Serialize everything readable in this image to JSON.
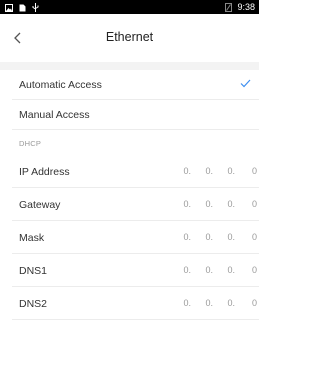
{
  "status_bar": {
    "time": "9:38",
    "icons": [
      "image-icon",
      "file-icon",
      "usb-icon",
      "signal-icon"
    ]
  },
  "header": {
    "title": "Ethernet",
    "back_icon": "chevron-left-icon"
  },
  "modes": [
    {
      "label": "Automatic Access",
      "selected": true
    },
    {
      "label": "Manual Access",
      "selected": false
    }
  ],
  "section": {
    "label": "DHCP"
  },
  "fields": [
    {
      "label": "IP Address",
      "octets": [
        "0.",
        "0.",
        "0.",
        "0"
      ]
    },
    {
      "label": "Gateway",
      "octets": [
        "0.",
        "0.",
        "0.",
        "0"
      ]
    },
    {
      "label": "Mask",
      "octets": [
        "0.",
        "0.",
        "0.",
        "0"
      ]
    },
    {
      "label": "DNS1",
      "octets": [
        "0.",
        "0.",
        "0.",
        "0"
      ]
    },
    {
      "label": "DNS2",
      "octets": [
        "0.",
        "0.",
        "0.",
        "0"
      ]
    }
  ],
  "colors": {
    "accent": "#3d8ef0",
    "status_bar": "#000000",
    "divider": "#ececec",
    "muted_text": "#9a9a9a"
  }
}
